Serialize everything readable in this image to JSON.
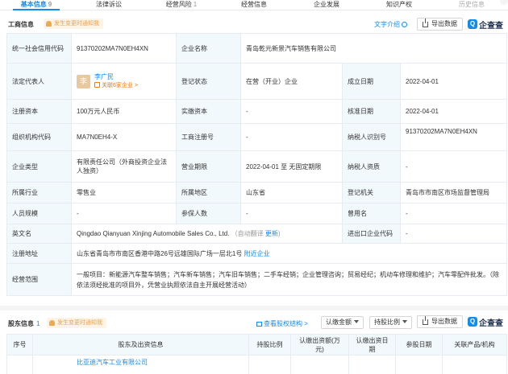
{
  "tabs": [
    {
      "label": "基本信息",
      "count": "9"
    },
    {
      "label": "法律诉讼",
      "count": ""
    },
    {
      "label": "经营风险",
      "count": "1"
    },
    {
      "label": "经营信息",
      "count": ""
    },
    {
      "label": "企业发展",
      "count": ""
    },
    {
      "label": "知识产权",
      "count": ""
    },
    {
      "label": "历史信息",
      "count": ""
    }
  ],
  "business": {
    "title": "工商信息",
    "notice": "发生变更时通知我",
    "text_intro": "文字介绍",
    "export": "导出数据",
    "logo": "企查查",
    "logo_mark": "Q"
  },
  "info": {
    "credit_code_label": "统一社会信用代码",
    "credit_code": "91370202MA7N0EH4XN",
    "name_label": "企业名称",
    "name": "青岛乾元新景汽车销售有限公司",
    "legal_label": "法定代表人",
    "legal_avatar": "李",
    "legal_name": "李广民",
    "legal_rel": "关联6家企业 >",
    "status_label": "登记状态",
    "status": "在营（开业）企业",
    "founded_label": "成立日期",
    "founded": "2022-04-01",
    "capital_label": "注册资本",
    "capital": "100万元人民币",
    "paid_label": "实缴资本",
    "paid": "-",
    "approve_label": "核准日期",
    "approve": "2022-04-01",
    "org_label": "组织机构代码",
    "org": "MA7N0EH4-X",
    "reg_no_label": "工商注册号",
    "reg_no": "-",
    "tax_label": "纳税人识别号",
    "tax": "91370202MA7N0EH4XN",
    "type_label": "企业类型",
    "type": "有限责任公司（外商投资企业法人独资）",
    "term_label": "营业期限",
    "term": "2022-04-01 至 无固定期限",
    "taxq_label": "纳税人资质",
    "taxq": "-",
    "industry_label": "所属行业",
    "industry": "零售业",
    "region_label": "所属地区",
    "region": "山东省",
    "authority_label": "登记机关",
    "authority": "青岛市市南区市场监督管理局",
    "staff_label": "人员规模",
    "staff": "-",
    "insured_label": "参保人数",
    "insured": "-",
    "former_label": "曾用名",
    "former": "-",
    "en_label": "英文名",
    "en": "Qingdao Qianyuan Xinjing Automobile Sales Co., Ltd.",
    "en_auto": "（自动翻译",
    "en_update": "更新",
    "ie_label": "进出口企业代码",
    "ie": "-",
    "addr_label": "注册地址",
    "addr": "山东省青岛市市南区香港中路26号远雄国际广场一层北1号",
    "addr_link": "附近企业",
    "scope_label": "经营范围",
    "scope": "一般项目：新能源汽车整车销售；汽车新车销售；汽车旧车销售；二手车经销；企业管理咨询；贸易经纪；机动车修理和维护；汽车零配件批发。（除依法须经批准的项目外，凭营业执照依法自主开展经营活动）"
  },
  "shareholder": {
    "title": "股东信息",
    "count": "1",
    "notice": "发生变更时通知我",
    "structure": "查看股权结构 >",
    "sel1": "认缴金额",
    "sel2": "持股比例",
    "export": "导出数据",
    "logo": "企查查",
    "logo_mark": "Q",
    "headers": [
      "序号",
      "股东及出资信息",
      "持股比例",
      "认缴出资额(万元)",
      "认缴出资日期",
      "参股日期",
      "关联产品/机构"
    ],
    "row1_name": "比亚迪汽车工业有限公司"
  }
}
